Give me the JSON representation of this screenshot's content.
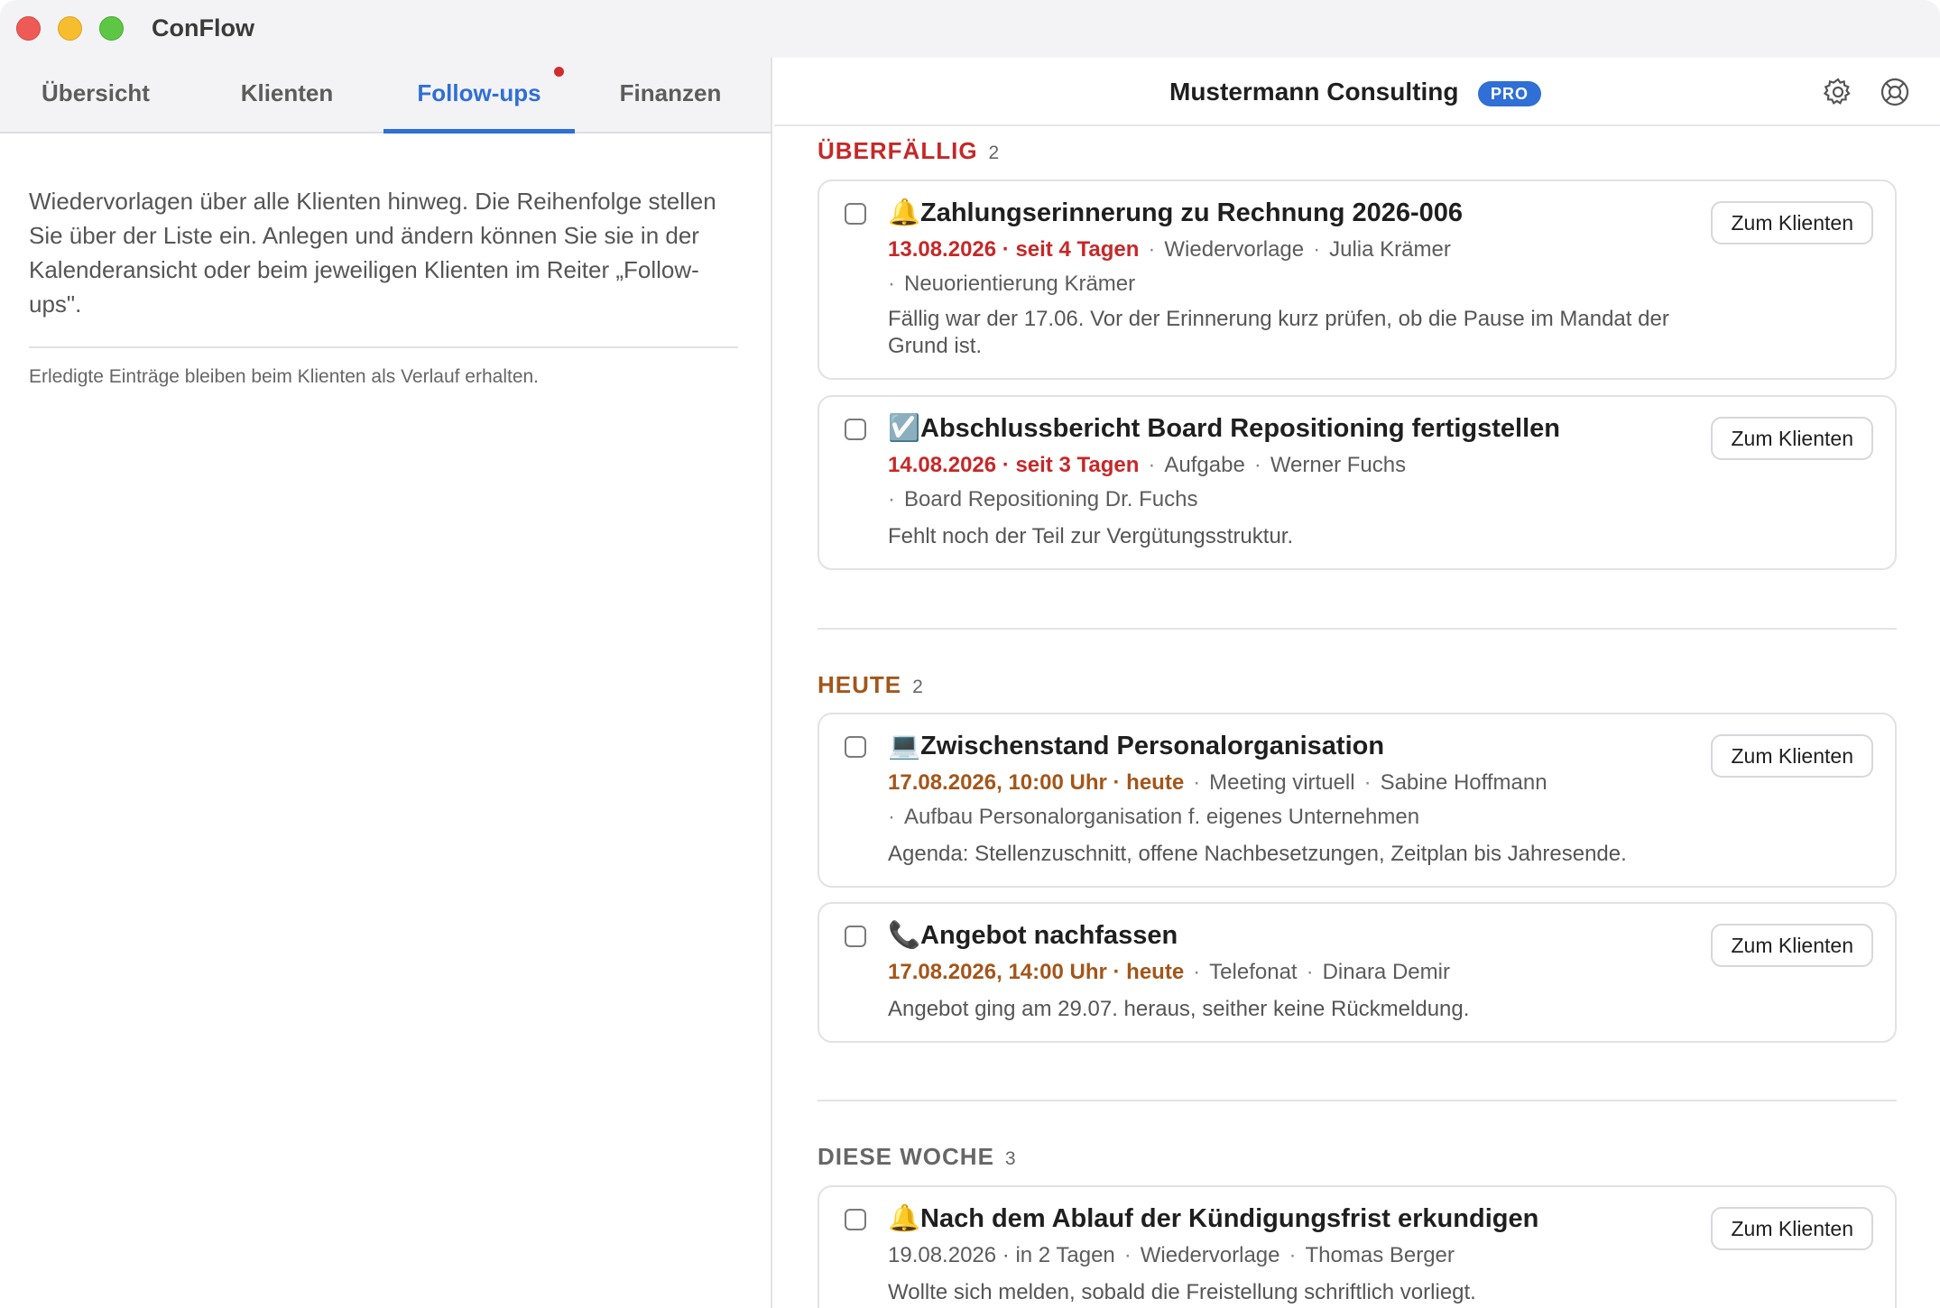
{
  "app": {
    "title": "ConFlow"
  },
  "tabs": [
    {
      "label": "Übersicht"
    },
    {
      "label": "Klienten"
    },
    {
      "label": "Follow-ups"
    },
    {
      "label": "Finanzen"
    }
  ],
  "left": {
    "intro": "Wiedervorlagen über alle Klienten hinweg. Die Reihenfolge stellen Sie über der Liste ein. Anlegen und ändern können Sie sie in der Kalenderansicht oder beim jeweiligen Klienten im Reiter „Follow-ups\".",
    "footnote": "Erledigte Einträge bleiben beim Klienten als Verlauf erhalten."
  },
  "header": {
    "org": "Mustermann Consulting",
    "badge": "PRO"
  },
  "sections": {
    "overdue": {
      "label": "ÜBERFÄLLIG",
      "count": "2"
    },
    "today": {
      "label": "HEUTE",
      "count": "2"
    },
    "week": {
      "label": "DIESE WOCHE",
      "count": "3"
    }
  },
  "button_label": "Zum Klienten",
  "items": [
    {
      "emoji": "🔔",
      "title": "Zahlungserinnerung zu Rechnung 2026-006",
      "due": "13.08.2026 · seit 4 Tagen",
      "type": "Wiedervorlage",
      "client": "Julia Krämer",
      "project": "Neuorientierung Krämer",
      "note": "Fällig war der 17.06. Vor der Erinnerung kurz prüfen, ob die Pause im Mandat der Grund ist."
    },
    {
      "emoji": "☑️",
      "title": "Abschlussbericht Board Repositioning fertigstellen",
      "due": "14.08.2026 · seit 3 Tagen",
      "type": "Aufgabe",
      "client": "Werner Fuchs",
      "project": "Board Repositioning Dr. Fuchs",
      "note": "Fehlt noch der Teil zur Vergütungsstruktur."
    },
    {
      "emoji": "💻",
      "title": "Zwischenstand Personalorganisation",
      "due": "17.08.2026, 10:00 Uhr · heute",
      "type": "Meeting virtuell",
      "client": "Sabine Hoffmann",
      "project": "Aufbau Personalorganisation f. eigenes Unternehmen",
      "note": "Agenda: Stellenzuschnitt, offene Nachbesetzungen, Zeitplan bis Jahresende."
    },
    {
      "emoji": "📞",
      "title": "Angebot nachfassen",
      "due": "17.08.2026, 14:00 Uhr · heute",
      "type": "Telefonat",
      "client": "Dinara Demir",
      "note": "Angebot ging am 29.07. heraus, seither keine Rückmeldung."
    },
    {
      "emoji": "🔔",
      "title": "Nach dem Ablauf der Kündigungsfrist erkundigen",
      "due": "19.08.2026 · in 2 Tagen",
      "type": "Wiedervorlage",
      "client": "Thomas Berger",
      "note": "Wollte sich melden, sobald die Freistellung schriftlich vorliegt."
    }
  ],
  "colors": {
    "accent": "#2f6fd6",
    "overdue": "#c62828",
    "today": "#a3561a"
  },
  "icons": {
    "settings": "gear-icon",
    "help": "lifebuoy-icon"
  }
}
